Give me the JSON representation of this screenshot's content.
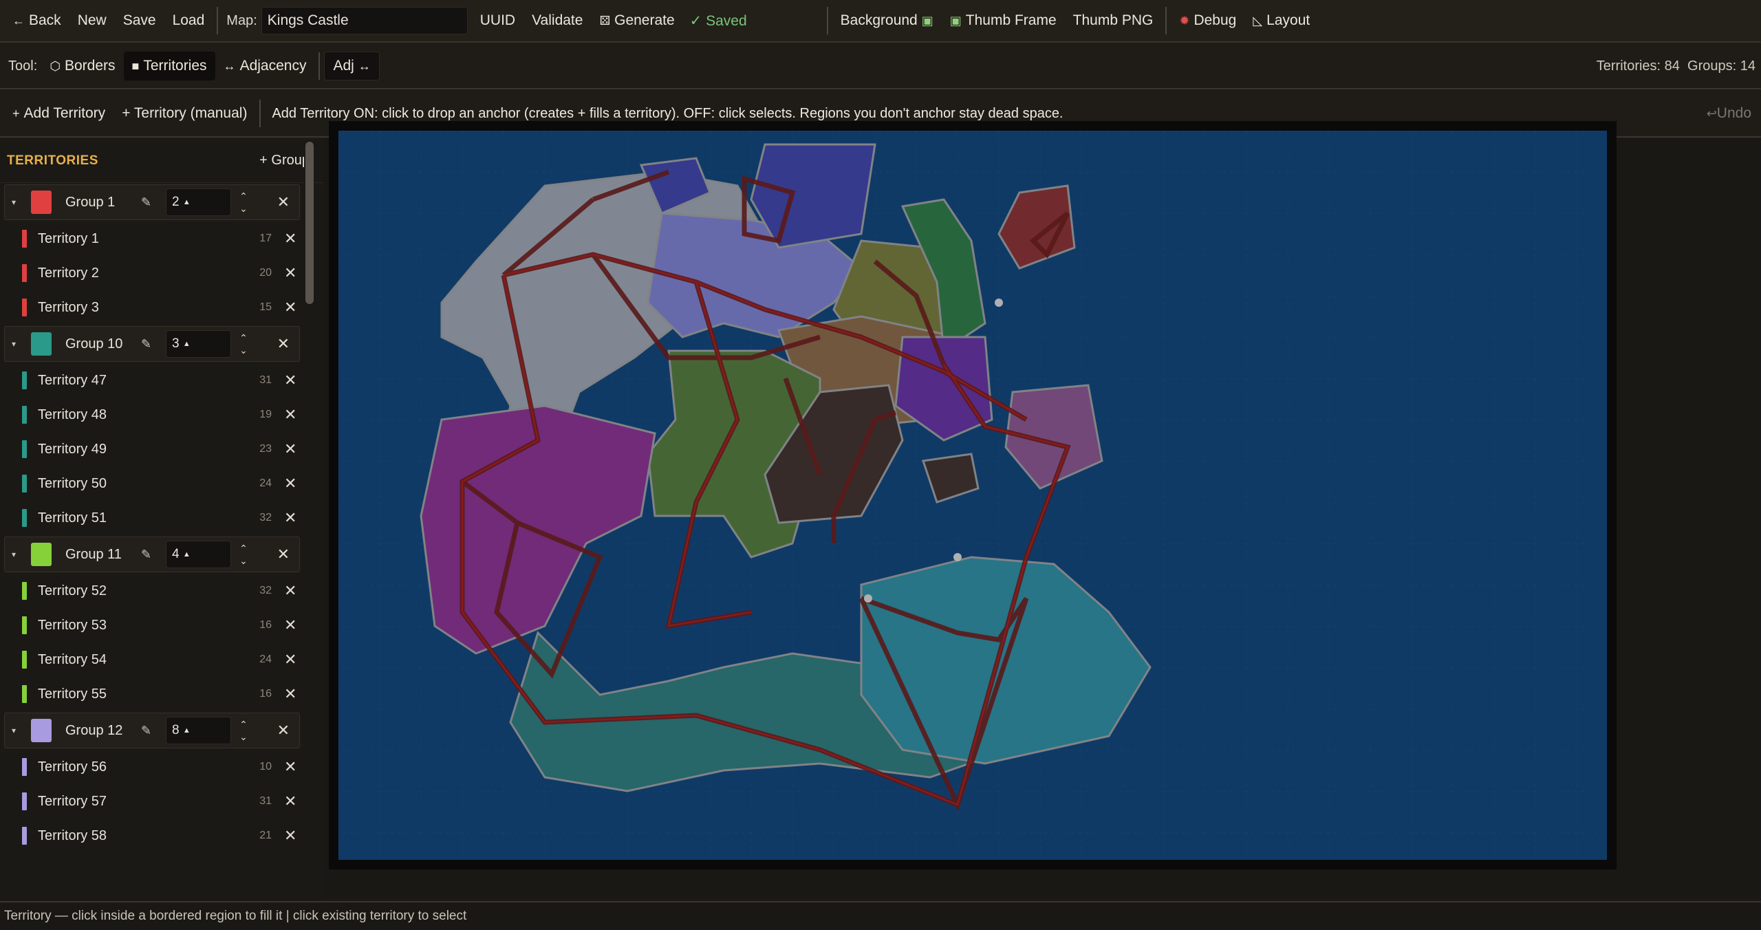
{
  "toolbar": {
    "back": "Back",
    "new": "New",
    "save": "Save",
    "load": "Load",
    "map_label": "Map:",
    "map_name": "Kings Castle",
    "uuid": "UUID",
    "validate": "Validate",
    "generate": "Generate",
    "saved": "✓ Saved",
    "background": "Background",
    "thumb_frame": "Thumb Frame",
    "thumb_png": "Thumb PNG",
    "debug": "Debug",
    "layout": "Layout"
  },
  "tools": {
    "label": "Tool:",
    "borders": "Borders",
    "territories": "Territories",
    "adjacency": "Adjacency",
    "adj": "Adj",
    "territories_count": "Territories: 84",
    "groups_count": "Groups: 14"
  },
  "addbar": {
    "add_territory": "Add Territory",
    "territory_manual": "+ Territory (manual)",
    "hint": "Add Territory ON: click to drop an anchor (creates + fills a territory).  OFF: click selects.  Regions you don't anchor stay dead space.",
    "undo": "Undo"
  },
  "sidebar": {
    "title": "TERRITORIES",
    "add_group": "+ Group",
    "groups": [
      {
        "name": "Group 1",
        "color": "#e04040",
        "value": "2",
        "territories": [
          {
            "name": "Territory 1",
            "n": "17"
          },
          {
            "name": "Territory 2",
            "n": "20"
          },
          {
            "name": "Territory 3",
            "n": "15"
          }
        ]
      },
      {
        "name": "Group 10",
        "color": "#2a9a8a",
        "value": "3",
        "territories": [
          {
            "name": "Territory 47",
            "n": "31"
          },
          {
            "name": "Territory 48",
            "n": "19"
          },
          {
            "name": "Territory 49",
            "n": "23"
          },
          {
            "name": "Territory 50",
            "n": "24"
          },
          {
            "name": "Territory 51",
            "n": "32"
          }
        ]
      },
      {
        "name": "Group 11",
        "color": "#86d13a",
        "value": "4",
        "territories": [
          {
            "name": "Territory 52",
            "n": "32"
          },
          {
            "name": "Territory 53",
            "n": "16"
          },
          {
            "name": "Territory 54",
            "n": "24"
          },
          {
            "name": "Territory 55",
            "n": "16"
          }
        ]
      },
      {
        "name": "Group 12",
        "color": "#a99be0",
        "value": "8",
        "territories": [
          {
            "name": "Territory 56",
            "n": "10"
          },
          {
            "name": "Territory 57",
            "n": "31"
          },
          {
            "name": "Territory 58",
            "n": "21"
          }
        ]
      }
    ]
  },
  "status": "Territory — click inside a bordered region to fill it  |  click existing territory to select"
}
